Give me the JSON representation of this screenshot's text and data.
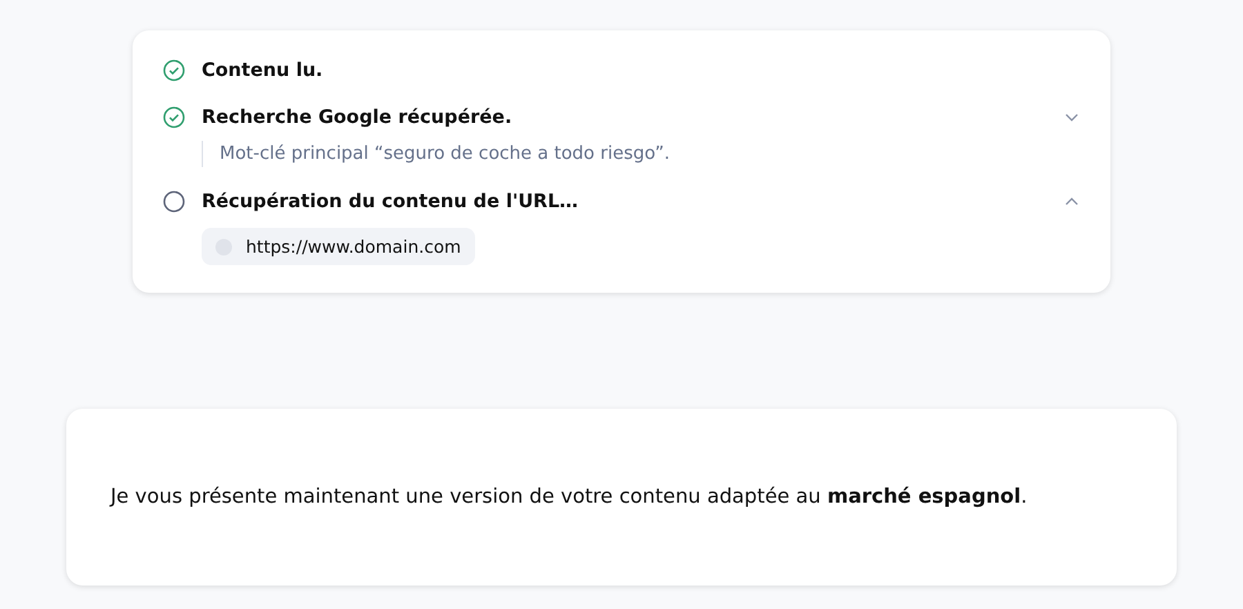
{
  "progress_card": {
    "steps": [
      {
        "label": "Contenu lu.",
        "kind": "done"
      },
      {
        "label": "Recherche Google récupérée.",
        "kind": "done",
        "expanded": false,
        "detail": "Mot-clé principal “seguro de coche a todo riesgo”."
      },
      {
        "label": "Récupération du contenu de l'URL…",
        "kind": "pending",
        "expanded": true,
        "link": "https://www.domain.com"
      }
    ]
  },
  "message": {
    "text": "Je vous présente maintenant une version de votre contenu adaptée au **marché espagnol**."
  }
}
